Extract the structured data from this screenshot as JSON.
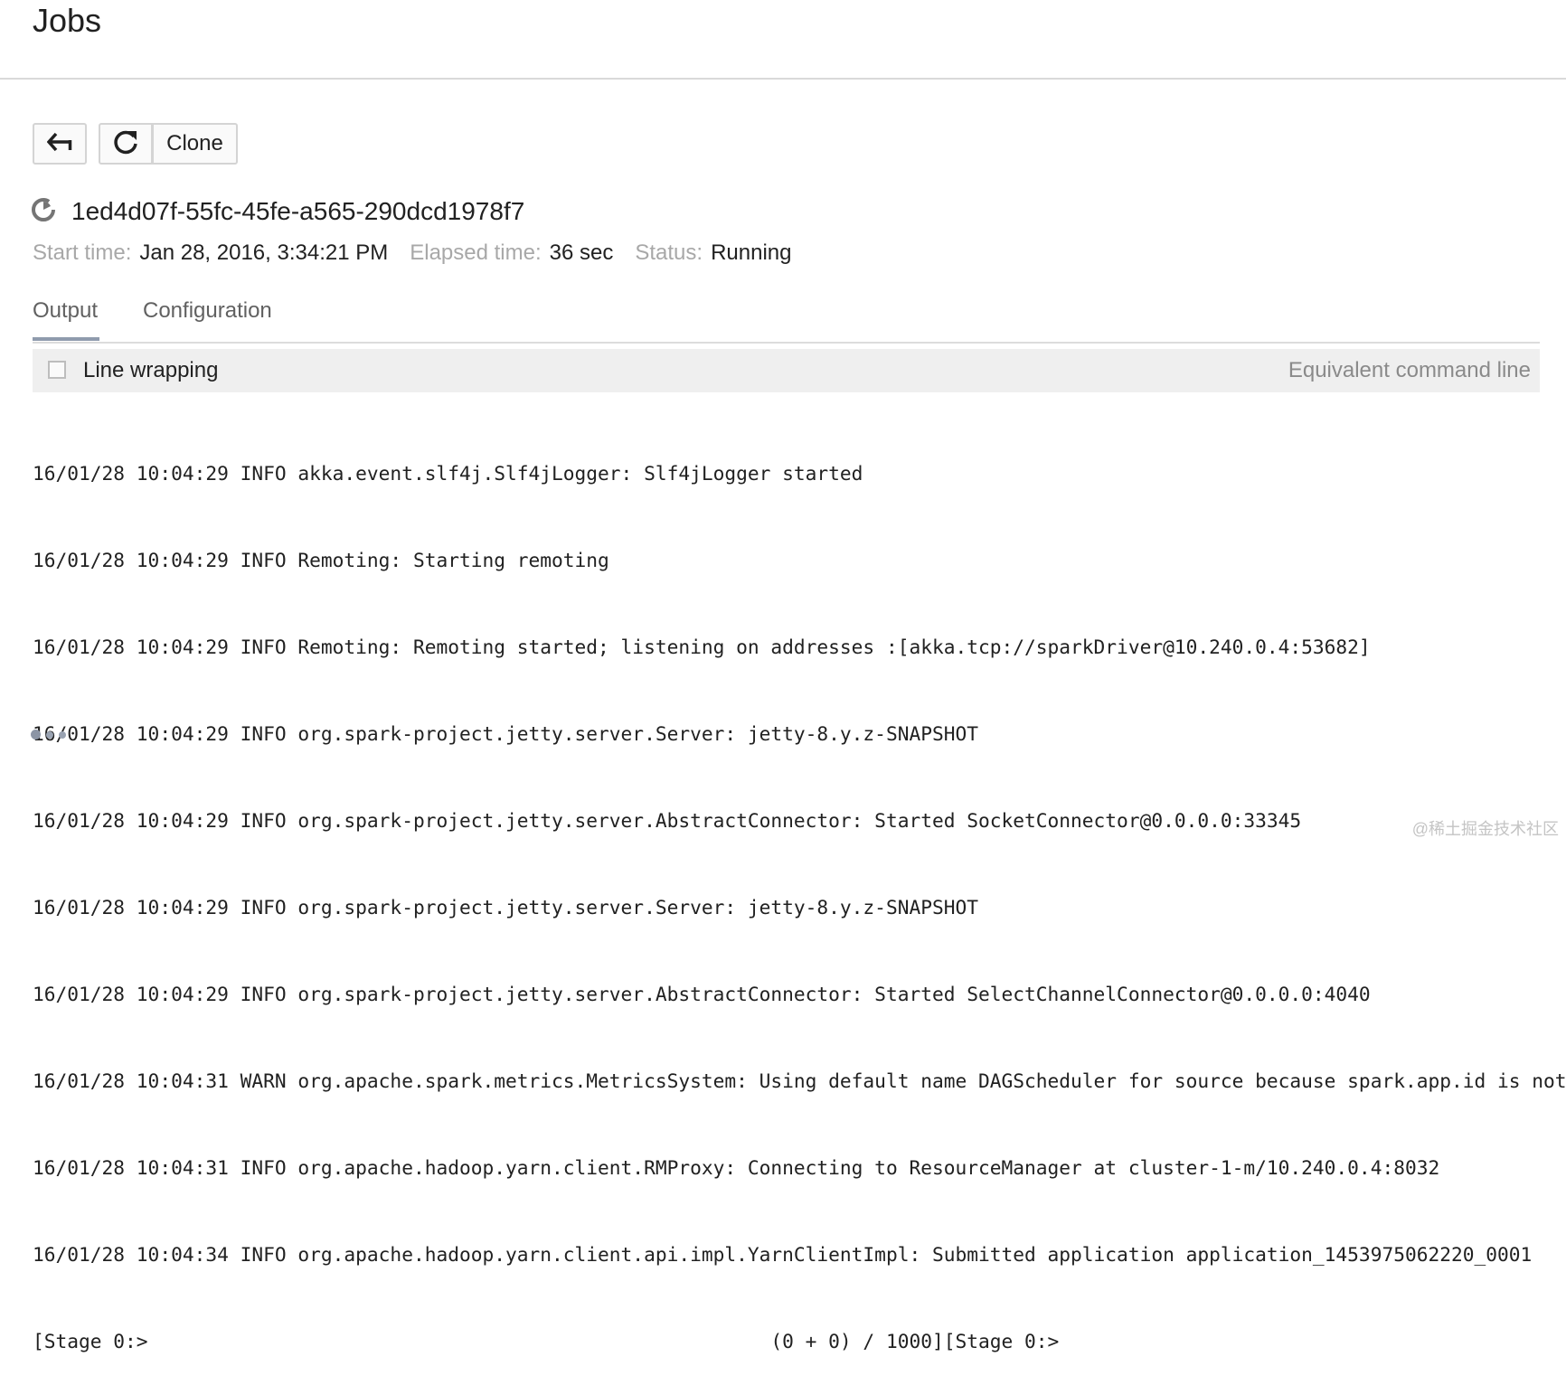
{
  "header": {
    "title": "Jobs"
  },
  "toolbar": {
    "back_icon": "back-arrow-icon",
    "refresh_icon": "refresh-icon",
    "clone_label": "Clone"
  },
  "job": {
    "status_icon": "running-spinner-icon",
    "id": "1ed4d07f-55fc-45fe-a565-290dcd1978f7",
    "start_time_label": "Start time:",
    "start_time": "Jan 28, 2016, 3:34:21 PM",
    "elapsed_label": "Elapsed time:",
    "elapsed": "36 sec",
    "status_label": "Status:",
    "status": "Running"
  },
  "tabs": [
    {
      "label": "Output",
      "active": true
    },
    {
      "label": "Configuration",
      "active": false
    }
  ],
  "output_bar": {
    "line_wrapping_label": "Line wrapping",
    "line_wrapping_checked": false,
    "equivalent_command_label": "Equivalent command line"
  },
  "log": [
    "16/01/28 10:04:29 INFO akka.event.slf4j.Slf4jLogger: Slf4jLogger started",
    "16/01/28 10:04:29 INFO Remoting: Starting remoting",
    "16/01/28 10:04:29 INFO Remoting: Remoting started; listening on addresses :[akka.tcp://sparkDriver@10.240.0.4:53682]",
    "16/01/28 10:04:29 INFO org.spark-project.jetty.server.Server: jetty-8.y.z-SNAPSHOT",
    "16/01/28 10:04:29 INFO org.spark-project.jetty.server.AbstractConnector: Started SocketConnector@0.0.0.0:33345",
    "16/01/28 10:04:29 INFO org.spark-project.jetty.server.Server: jetty-8.y.z-SNAPSHOT",
    "16/01/28 10:04:29 INFO org.spark-project.jetty.server.AbstractConnector: Started SelectChannelConnector@0.0.0.0:4040",
    "16/01/28 10:04:31 WARN org.apache.spark.metrics.MetricsSystem: Using default name DAGScheduler for source because spark.app.id is not set.",
    "16/01/28 10:04:31 INFO org.apache.hadoop.yarn.client.RMProxy: Connecting to ResourceManager at cluster-1-m/10.240.0.4:8032",
    "16/01/28 10:04:34 INFO org.apache.hadoop.yarn.client.api.impl.YarnClientImpl: Submitted application application_1453975062220_0001",
    "[Stage 0:>                                                      (0 + 0) / 1000][Stage 0:>"
  ],
  "loading_indicator": "loading-dots-icon",
  "watermark": "@稀土掘金技术社区",
  "colors": {
    "tab_active_underline": "#8f9bad",
    "label_gray": "#a8a8a8",
    "output_bar_bg": "#efefef"
  }
}
